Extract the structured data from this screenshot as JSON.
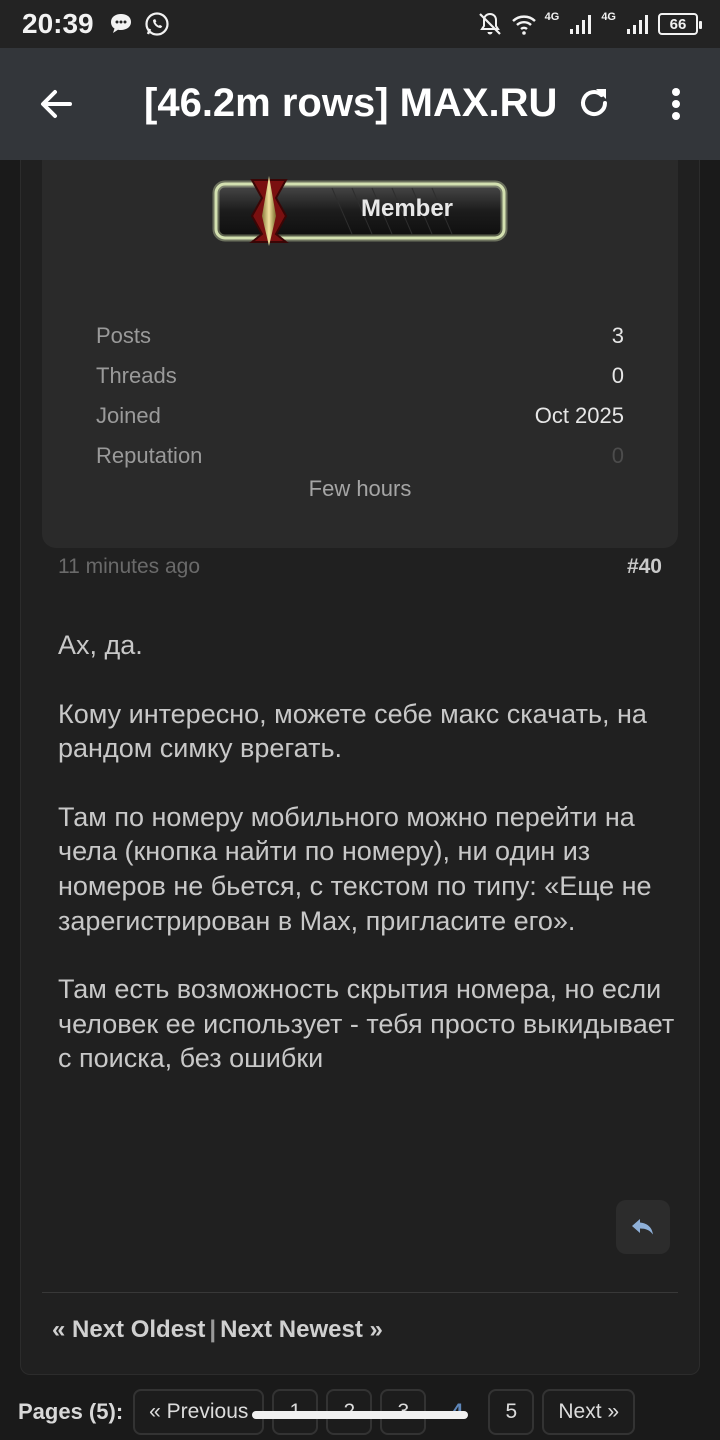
{
  "status_bar": {
    "time": "20:39",
    "network_label": "4G",
    "network_label_2": "4G",
    "battery": "66"
  },
  "app_bar": {
    "title": "[46.2m rows] MAX.RU"
  },
  "profile": {
    "badge_label": "Member",
    "stats": [
      {
        "label": "Posts",
        "value": "3"
      },
      {
        "label": "Threads",
        "value": "0"
      },
      {
        "label": "Joined",
        "value": "Oct 2025"
      },
      {
        "label": "Reputation",
        "value": "0"
      }
    ],
    "time_online": "Few hours"
  },
  "post": {
    "time": "11 minutes ago",
    "number": "#40",
    "paragraphs": [
      "Ах, да.",
      "Кому интересно, можете себе макс скачать, на рандом симку врегать.",
      "Там по номеру мобильного можно перейти на чела (кнопка найти по номеру), ни один из номеров не бьется, с текстом по типу: «Еще не зарегистрирован в Max, пригласите его».",
      "Там есть возможность скрытия номера, но если человек ее использует - тебя просто выкидывает с поиска, без ошибки"
    ]
  },
  "thread_nav": {
    "next_oldest": "« Next Oldest",
    "separator": "|",
    "next_newest": "Next Newest »"
  },
  "pagination": {
    "label": "Pages (5):",
    "previous": "« Previous",
    "pages": [
      "1",
      "2",
      "3",
      "4",
      "5"
    ],
    "current_page": "4",
    "next": "Next »"
  },
  "colors": {
    "background": "#1a1a1a",
    "app_bar": "#33363a",
    "card": "#2a2a2a",
    "current_page": "#5e86b8",
    "reply_icon": "#8fb0d8"
  }
}
